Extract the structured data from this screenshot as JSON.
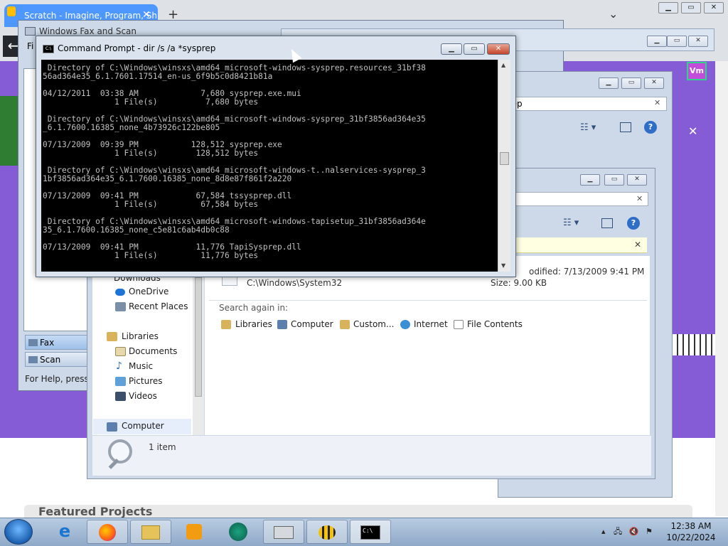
{
  "browser": {
    "tab_title": "Scratch - Imagine, Program, Sh",
    "tab_close": "✕",
    "new_tab": "+",
    "tab_list": "⌄",
    "back": "←",
    "vm_badge": "Vm",
    "featured": "Featured Projects"
  },
  "fax": {
    "title": "Windows Fax and Scan",
    "menu_partial": "Fi",
    "nav": [
      "Fax",
      "Scan"
    ],
    "status": "For Help, press F"
  },
  "explorer_mid": {
    "search_value": "rep",
    "search_clear": "✕"
  },
  "explorer": {
    "search_clear": "✕",
    "info_close": "✕",
    "nav_items": [
      {
        "label": "Downloads"
      },
      {
        "label": "OneDrive"
      },
      {
        "label": "Recent Places"
      },
      {
        "label": "Libraries"
      },
      {
        "label": "Documents"
      },
      {
        "label": "Music"
      },
      {
        "label": "Pictures"
      },
      {
        "label": "Videos"
      },
      {
        "label": "Computer"
      }
    ],
    "result": {
      "path": "C:\\Windows\\System32",
      "modified": "odified: 7/13/2009 9:41 PM",
      "size": "Size: 9.00 KB"
    },
    "search_again_label": "Search again in:",
    "search_again": [
      "Libraries",
      "Computer",
      "Custom...",
      "Internet",
      "File Contents"
    ],
    "status_count": "1 item"
  },
  "cmd": {
    "title": "Command Prompt - dir  /s /a *sysprep",
    "icon_text": "C:\\",
    "minimize": "▁",
    "maximize": "▭",
    "close": "✕",
    "output": " Directory of C:\\Windows\\winsxs\\amd64_microsoft-windows-sysprep.resources_31bf38\n56ad364e35_6.1.7601.17514_en-us_6f9b5c0d8421b81a\n\n04/12/2011  03:38 AM             7,680 sysprep.exe.mui\n               1 File(s)          7,680 bytes\n\n Directory of C:\\Windows\\winsxs\\amd64_microsoft-windows-sysprep_31bf3856ad364e35\n_6.1.7600.16385_none_4b73926c122be805\n\n07/13/2009  09:39 PM           128,512 sysprep.exe\n               1 File(s)        128,512 bytes\n\n Directory of C:\\Windows\\winsxs\\amd64_microsoft-windows-t..nalservices-sysprep_3\n1bf3856ad364e35_6.1.7600.16385_none_8d8e87f861f2a220\n\n07/13/2009  09:41 PM            67,584 tssysprep.dll\n               1 File(s)         67,584 bytes\n\n Directory of C:\\Windows\\winsxs\\amd64_microsoft-windows-tapisetup_31bf3856ad364e\n35_6.1.7600.16385_none_c5e81c6ab4db0c88\n\n07/13/2009  09:41 PM            11,776 TapiSysprep.dll\n               1 File(s)         11,776 bytes"
  },
  "taskbar": {
    "items": [
      "internet-explorer-icon",
      "firefox-icon",
      "file-explorer-icon",
      "media-player-icon",
      "scratch-icon",
      "fax-scan-icon",
      "snipping-bee-icon",
      "command-prompt-icon"
    ],
    "cmd_icon_text": "C:\\",
    "clock_time": "12:38 AM",
    "clock_date": "10/22/2024"
  },
  "colors": {
    "scratch_purple": "#855cd6",
    "scratch_blue": "#4d97ff",
    "console_bg": "#000000",
    "console_fg": "#c0c0c0"
  }
}
